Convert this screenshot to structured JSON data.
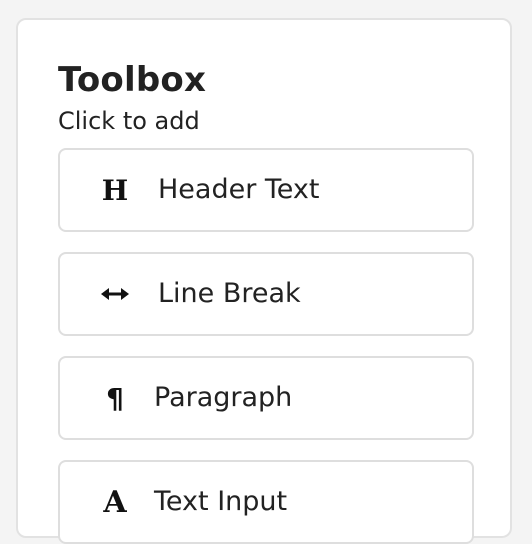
{
  "toolbox": {
    "title": "Toolbox",
    "subtitle": "Click to add",
    "items": [
      {
        "label": "Header Text",
        "icon": "header-icon"
      },
      {
        "label": "Line Break",
        "icon": "arrows-h-icon"
      },
      {
        "label": "Paragraph",
        "icon": "paragraph-icon"
      },
      {
        "label": "Text Input",
        "icon": "font-icon"
      }
    ]
  }
}
